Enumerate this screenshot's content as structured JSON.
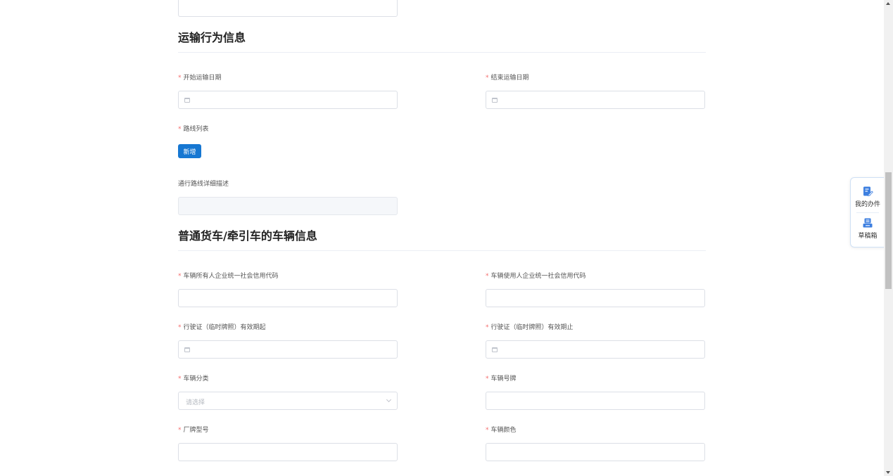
{
  "transport": {
    "title": "运输行为信息",
    "start_date_label": "开始运输日期",
    "end_date_label": "结束运输日期",
    "route_list_label": "路线列表",
    "add_button": "新增",
    "route_desc_label": "通行路线详细描述"
  },
  "vehicle": {
    "title": "普通货车/牵引车的车辆信息",
    "owner_code_label": "车辆所有人企业统一社会信用代码",
    "user_code_label": "车辆使用人企业统一社会信用代码",
    "license_start_label": "行驶证（临时牌照）有效期起",
    "license_end_label": "行驶证（临时牌照）有效期止",
    "category_label": "车辆分类",
    "category_placeholder": "请选择",
    "plate_label": "车辆号牌",
    "brand_model_label": "厂牌型号",
    "color_label": "车辆颜色"
  },
  "float_panel": {
    "my_tasks": "我的办件",
    "drafts": "草稿箱"
  },
  "required_marker": "*",
  "colors": {
    "primary": "#1677d2",
    "required": "#f56c6c"
  },
  "icons": {
    "date": "calendar-icon",
    "select": "chevron-down-icon",
    "tasks": "edit-document-icon",
    "drafts": "draft-box-icon"
  }
}
